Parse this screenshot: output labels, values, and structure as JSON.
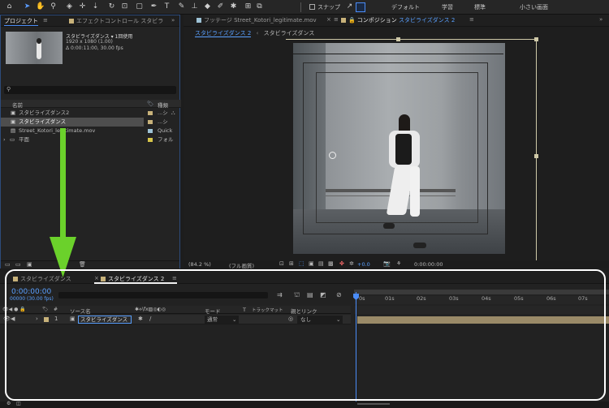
{
  "toolbar": {
    "snap_label": "スナップ",
    "workspaces": [
      "デフォルト",
      "学習",
      "標準",
      "小さい画面"
    ],
    "chevron": "»"
  },
  "project_panel": {
    "tab_label": "プロジェクト",
    "effect_tab_label": "エフェクトコントロール スタビラ",
    "menu_icon": "≡",
    "expand": "»",
    "thumbnail_info": {
      "name": "スタビライズダンス ▾ 1回使用",
      "resolution": "1920 x 1080 (1.00)",
      "duration": "Δ 0:00:11:00, 30.00 fps"
    },
    "search_placeholder": "",
    "col_name": "名前",
    "col_type": "種類",
    "items": [
      {
        "name": "スタビライズダンス2",
        "type": "...シ",
        "color": "#c8b27a"
      },
      {
        "name": "スタビライズダンス",
        "type": "...シ",
        "color": "#c8b27a"
      },
      {
        "name": "Street_Kotori_legitimate.mov",
        "type": "Quick",
        "color": "#9ec3d6"
      },
      {
        "name": "平面",
        "type": "フォル",
        "color": "#d7c64a"
      }
    ]
  },
  "viewer": {
    "footage_tab": "フッテージ Street_Kotori_legitimate.mov",
    "comp_tab_prefix": "コンポジション",
    "comp_tab_name": "スタビライズダンス 2",
    "breadcrumb_active": "スタビライズダンス 2",
    "breadcrumb_other": "スタビライズダンス",
    "zoom": "(84.2 %)",
    "quality": "(フル画質)",
    "offset": "+0.0",
    "timecode": "0:00:00:00"
  },
  "timeline": {
    "tab_left": "スタビライズダンス",
    "tab_active": "スタビライズダンス 2",
    "timecode": "0:00:00:00",
    "frames": "00000 (30.00 fps)",
    "col_source": "ソース名",
    "col_mode": "モード",
    "col_t": "T",
    "col_trackmatte": "トラックマット",
    "col_parent": "親とリンク",
    "layer": {
      "number": "1",
      "name": "スタビライズダンス",
      "mode": "通常",
      "parent": "なし"
    },
    "ruler": [
      "0s",
      "01s",
      "02s",
      "03s",
      "04s",
      "05s",
      "06s",
      "07s"
    ]
  },
  "colors": {
    "accent_blue": "#4a8cf7",
    "arrow_green": "#6bd12b",
    "layer_bar": "#9a8a68"
  }
}
